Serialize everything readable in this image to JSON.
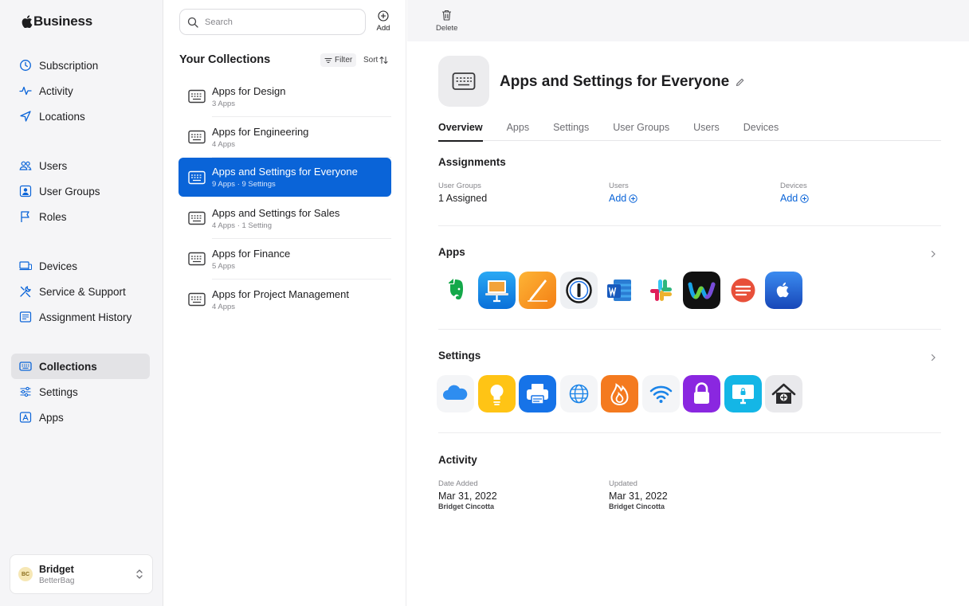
{
  "brand": {
    "name": "Business"
  },
  "sidebar": {
    "groups": [
      [
        {
          "label": "Subscription",
          "icon": "subscription-icon"
        },
        {
          "label": "Activity",
          "icon": "activity-icon"
        },
        {
          "label": "Locations",
          "icon": "location-arrow-icon"
        }
      ],
      [
        {
          "label": "Users",
          "icon": "users-icon"
        },
        {
          "label": "User Groups",
          "icon": "user-groups-icon"
        },
        {
          "label": "Roles",
          "icon": "flag-icon"
        }
      ],
      [
        {
          "label": "Devices",
          "icon": "devices-icon"
        },
        {
          "label": "Service & Support",
          "icon": "tools-icon"
        },
        {
          "label": "Assignment History",
          "icon": "history-icon"
        }
      ],
      [
        {
          "label": "Collections",
          "icon": "collections-icon",
          "active": true
        },
        {
          "label": "Settings",
          "icon": "sliders-icon"
        },
        {
          "label": "Apps",
          "icon": "apps-icon"
        }
      ]
    ],
    "account": {
      "initials": "BC",
      "name": "Bridget",
      "org": "BetterBag"
    }
  },
  "list": {
    "search_placeholder": "Search",
    "add_label": "Add",
    "title": "Your Collections",
    "filter_label": "Filter",
    "sort_label": "Sort",
    "items": [
      {
        "name": "Apps for Design",
        "sub": "3 Apps"
      },
      {
        "name": "Apps for Engineering",
        "sub": "4 Apps"
      },
      {
        "name": "Apps and Settings for Everyone",
        "sub": "9 Apps · 9 Settings",
        "selected": true
      },
      {
        "name": "Apps and Settings for Sales",
        "sub": "4 Apps · 1 Setting"
      },
      {
        "name": "Apps for Finance",
        "sub": "5 Apps"
      },
      {
        "name": "Apps for Project Management",
        "sub": "4 Apps"
      }
    ]
  },
  "detail": {
    "delete_label": "Delete",
    "title": "Apps and Settings for Everyone",
    "tabs": [
      "Overview",
      "Apps",
      "Settings",
      "User Groups",
      "Users",
      "Devices"
    ],
    "assignments": {
      "title": "Assignments",
      "user_groups_label": "User Groups",
      "user_groups_value": "1 Assigned",
      "users_label": "Users",
      "users_link": "Add",
      "devices_label": "Devices",
      "devices_link": "Add"
    },
    "apps": {
      "title": "Apps",
      "icons": [
        "evernote-icon",
        "keynote-icon",
        "pages-icon",
        "1password-icon",
        "word-icon",
        "slack-icon",
        "webex-icon",
        "speech-app-icon",
        "apple-business-icon"
      ]
    },
    "settings": {
      "title": "Settings",
      "icons": [
        "icloud-icon",
        "lightbulb-icon",
        "printer-icon",
        "globe-icon",
        "firewall-icon",
        "wifi-icon",
        "lock-icon",
        "screen-lock-icon",
        "home-security-icon"
      ]
    },
    "activity": {
      "title": "Activity",
      "date_added_label": "Date Added",
      "date_added_value": "Mar 31, 2022",
      "date_added_by": "Bridget Cincotta",
      "updated_label": "Updated",
      "updated_value": "Mar 31, 2022",
      "updated_by": "Bridget Cincotta"
    }
  },
  "colors": {
    "accent": "#0a64d8",
    "sidebar_bg": "#f5f5f7"
  }
}
